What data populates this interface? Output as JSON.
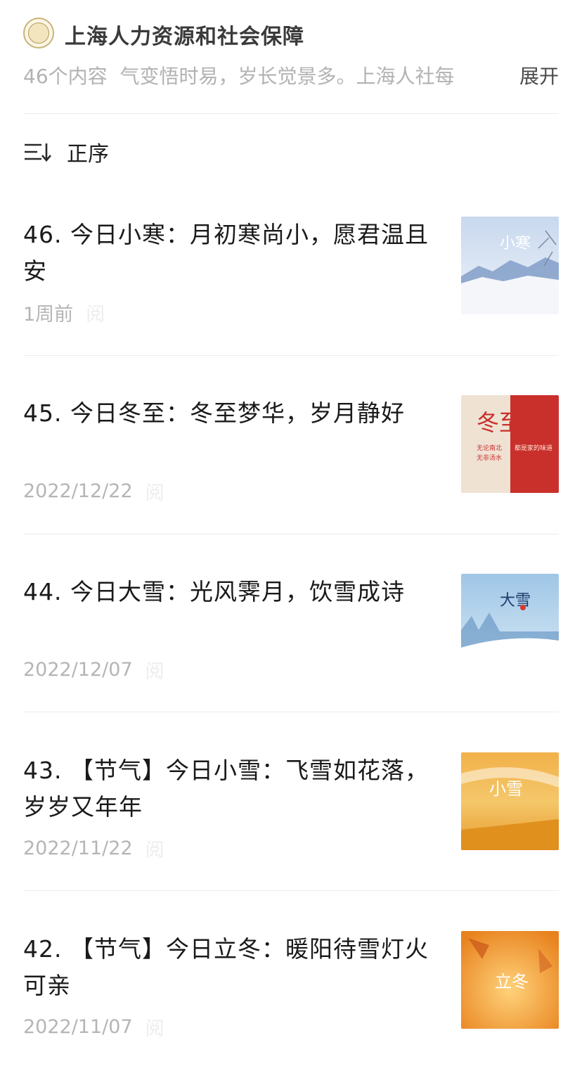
{
  "header": {
    "account_name": "上海人力资源和社会保障",
    "logo_text": "上海人社",
    "content_count": "46个内容",
    "description": "气变悟时易，岁长觉景多。上海人社每",
    "expand_label": "展开"
  },
  "sort": {
    "label": "正序",
    "icon": "sort-order-icon"
  },
  "articles": [
    {
      "title": "46. 今日小寒：月初寒尚小，愿君温且安",
      "date": "1周前",
      "read_hint": "阅",
      "thumb_text": "小寒"
    },
    {
      "title": "45. 今日冬至：冬至梦华，岁月静好",
      "date": "2022/12/22",
      "read_hint": "阅",
      "thumb_text": "冬至",
      "thumb_lines": [
        "无论南北",
        "无非汤水",
        "都是家的味道"
      ]
    },
    {
      "title": "44. 今日大雪：光风霁月，饮雪成诗",
      "date": "2022/12/07",
      "read_hint": "阅",
      "thumb_text": "大雪"
    },
    {
      "title": "43. 【节气】今日小雪：飞雪如花落，岁岁又年年",
      "date": "2022/11/22",
      "read_hint": "阅",
      "thumb_text": "小雪"
    },
    {
      "title": "42. 【节气】今日立冬：暖阳待雪灯火可亲",
      "date": "2022/11/07",
      "read_hint": "阅",
      "thumb_text": "立冬"
    }
  ],
  "colors": {
    "accent_gold": "#c9b37a",
    "winter_red": "#c9302c",
    "meta_gray": "#b5b5b5"
  }
}
